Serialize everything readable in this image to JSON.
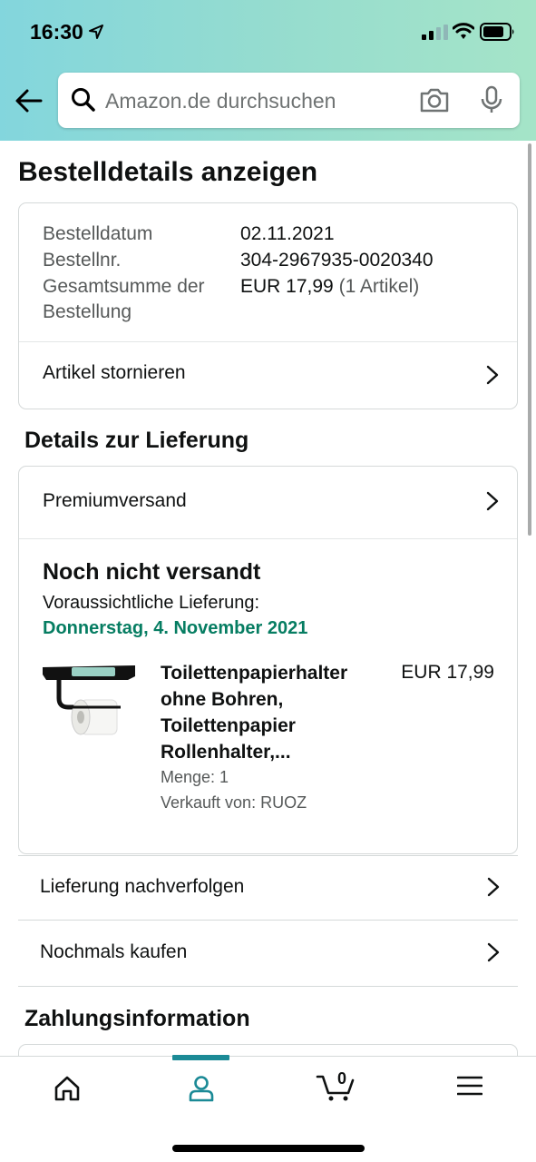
{
  "status_bar": {
    "time": "16:30"
  },
  "search": {
    "placeholder": "Amazon.de durchsuchen"
  },
  "page": {
    "title": "Bestelldetails anzeigen"
  },
  "order_summary": {
    "date_label": "Bestelldatum",
    "date_value": "02.11.2021",
    "number_label": "Bestellnr.",
    "number_value": "304-2967935-0020340",
    "total_label_line1": "Gesamtsumme der",
    "total_label_line2": "Bestellung",
    "total_value": "EUR 17,99",
    "total_items": "(1 Artikel)",
    "cancel_label": "Artikel stornieren"
  },
  "delivery_section": {
    "title": "Details zur Lieferung",
    "shipping_label": "Premiumversand",
    "status": "Noch nicht versandt",
    "estimate_label": "Voraussichtliche Lieferung:",
    "estimate_date": "Donnerstag, 4. November 2021",
    "product": {
      "title_line1": "Toilettenpapierhalter",
      "title_line2": "ohne Bohren,",
      "title_line3": "Toilettenpapier",
      "title_line4": "Rollenhalter,...",
      "price": "EUR 17,99",
      "quantity": "Menge: 1",
      "seller": "Verkauft von: RUOZ"
    }
  },
  "actions": {
    "track_label": "Lieferung nachverfolgen",
    "buy_again_label": "Nochmals kaufen"
  },
  "payment_section": {
    "title": "Zahlungsinformation"
  },
  "tab_bar": {
    "active": "account",
    "cart_count": "0",
    "tabs": [
      "home-icon",
      "account-icon",
      "cart-icon",
      "menu-icon"
    ]
  },
  "colors": {
    "accent": "#1b8a96",
    "delivery_green": "#067d62",
    "text": "#0f1111",
    "muted": "#565959"
  }
}
